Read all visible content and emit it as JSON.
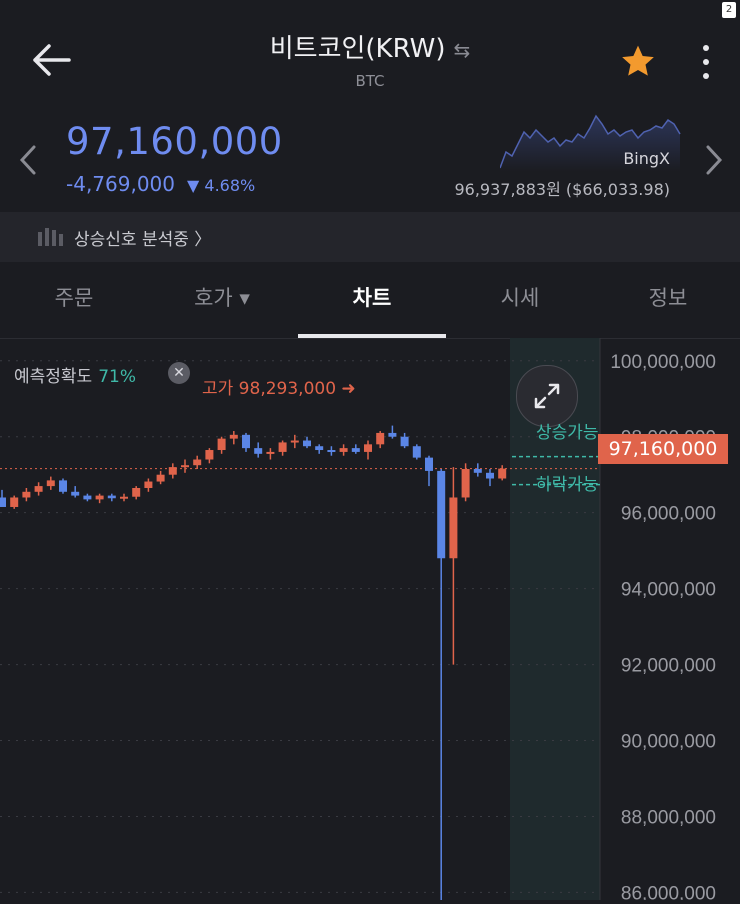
{
  "header": {
    "title": "비트코인(KRW)",
    "subtitle": "BTC",
    "page_badge": "2",
    "icons": [
      "back-arrow-icon",
      "swap-icon",
      "star-icon",
      "more-vertical-icon",
      "chevron-left-icon",
      "chevron-right-icon"
    ],
    "star_color": "#f39a2e"
  },
  "ticker": {
    "price": "97,160,000",
    "change_amount": "-4,769,000",
    "change_percent": "▼ 4.68%",
    "ref_exchange": "BingX",
    "ref_price": "96,937,883원 ($66,033.98)",
    "price_color": "#6f8cf0"
  },
  "signal": {
    "text": "상승신호 분석중 〉"
  },
  "tabs": [
    {
      "label": "주문",
      "active": false
    },
    {
      "label": "호가 ▾",
      "active": false
    },
    {
      "label": "차트",
      "active": true
    },
    {
      "label": "시세",
      "active": false
    },
    {
      "label": "정보",
      "active": false
    }
  ],
  "chart_overlay": {
    "accuracy_label": "예측정확도",
    "accuracy_value": "71%",
    "high_label": "고가 98,293,000 ➜",
    "current_price": "97,160,000",
    "up_label": "상승가능",
    "down_label": "하락가능",
    "up_color": "#e0644b",
    "down_color": "#5b86e6"
  },
  "chart_data": {
    "type": "candlestick",
    "ylim": [
      85800000,
      100600000
    ],
    "y_ticks": [
      100000000,
      98000000,
      96000000,
      94000000,
      92000000,
      90000000,
      88000000,
      86000000
    ],
    "y_tick_labels": [
      "100,000,000",
      "98,000,000",
      "96,000,000",
      "94,000,000",
      "92,000,000",
      "90,000,000",
      "88,000,000",
      "86,000,000"
    ],
    "current_price": 97160000,
    "high": 98293000,
    "candles": [
      [
        96400000,
        96600000,
        96150000,
        96150000
      ],
      [
        96150000,
        96450000,
        96100000,
        96400000
      ],
      [
        96400000,
        96650000,
        96300000,
        96550000
      ],
      [
        96550000,
        96800000,
        96450000,
        96700000
      ],
      [
        96700000,
        96950000,
        96600000,
        96850000
      ],
      [
        96850000,
        96900000,
        96500000,
        96550000
      ],
      [
        96550000,
        96700000,
        96400000,
        96450000
      ],
      [
        96450000,
        96500000,
        96300000,
        96350000
      ],
      [
        96350000,
        96500000,
        96250000,
        96450000
      ],
      [
        96450000,
        96500000,
        96300000,
        96380000
      ],
      [
        96380000,
        96500000,
        96300000,
        96420000
      ],
      [
        96420000,
        96700000,
        96350000,
        96650000
      ],
      [
        96650000,
        96900000,
        96550000,
        96820000
      ],
      [
        96820000,
        97100000,
        96750000,
        97000000
      ],
      [
        97000000,
        97300000,
        96900000,
        97200000
      ],
      [
        97200000,
        97400000,
        97050000,
        97250000
      ],
      [
        97250000,
        97500000,
        97150000,
        97400000
      ],
      [
        97400000,
        97700000,
        97300000,
        97650000
      ],
      [
        97650000,
        98000000,
        97550000,
        97950000
      ],
      [
        97950000,
        98150000,
        97800000,
        98050000
      ],
      [
        98050000,
        98100000,
        97600000,
        97700000
      ],
      [
        97700000,
        97850000,
        97450000,
        97550000
      ],
      [
        97550000,
        97700000,
        97400000,
        97600000
      ],
      [
        97600000,
        97900000,
        97500000,
        97850000
      ],
      [
        97850000,
        98050000,
        97700000,
        97900000
      ],
      [
        97900000,
        98000000,
        97700000,
        97750000
      ],
      [
        97750000,
        97800000,
        97550000,
        97650000
      ],
      [
        97650000,
        97750000,
        97500000,
        97600000
      ],
      [
        97600000,
        97800000,
        97500000,
        97700000
      ],
      [
        97700000,
        97800000,
        97550000,
        97600000
      ],
      [
        97600000,
        97900000,
        97400000,
        97800000
      ],
      [
        97800000,
        98150000,
        97700000,
        98100000
      ],
      [
        98100000,
        98293000,
        97950000,
        98000000
      ],
      [
        98000000,
        98100000,
        97700000,
        97750000
      ],
      [
        97750000,
        97800000,
        97400000,
        97450000
      ],
      [
        97450000,
        97500000,
        96700000,
        97100000
      ],
      [
        97100000,
        97150000,
        85800000,
        94800000
      ],
      [
        94800000,
        97200000,
        92000000,
        96400000
      ],
      [
        96400000,
        97300000,
        96300000,
        97150000
      ],
      [
        97150000,
        97300000,
        96950000,
        97050000
      ],
      [
        97050000,
        97150000,
        96700000,
        96900000
      ],
      [
        96900000,
        97250000,
        96850000,
        97160000
      ]
    ]
  }
}
